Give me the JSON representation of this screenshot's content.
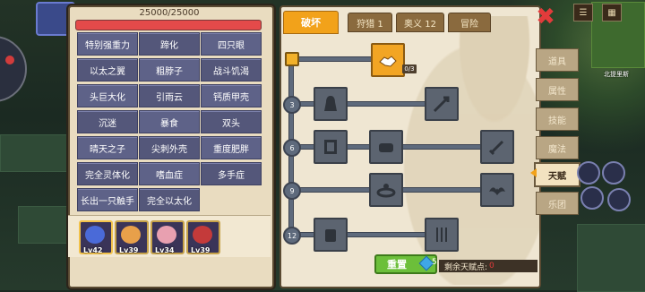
{
  "hp": {
    "text": "25000/25000",
    "fraction": 1.0
  },
  "modifiers": [
    [
      "特别强重力",
      "蹄化",
      "四只眼"
    ],
    [
      "以太之翼",
      "粗脖子",
      "战斗饥渴"
    ],
    [
      "头巨大化",
      "引雨云",
      "钙质甲壳"
    ],
    [
      "沉迷",
      "暴食",
      "双头"
    ],
    [
      "晴天之子",
      "尖刺外壳",
      "重度肥胖"
    ],
    [
      "完全灵体化",
      "嗜血症",
      "多手症"
    ],
    [
      "长出一只触手",
      "完全以太化"
    ]
  ],
  "units": [
    {
      "level": "Lv42",
      "color": "#4a6ad8"
    },
    {
      "level": "Lv39",
      "color": "#e8a04a"
    },
    {
      "level": "Lv34",
      "color": "#e8a0b0"
    },
    {
      "level": "Lv39",
      "color": "#c43a3a"
    }
  ],
  "tabs": [
    "破坏",
    "狩猎 1",
    "奥义 12",
    "冒险"
  ],
  "talent_tree": {
    "top_progress": "0/3",
    "rows": [
      "3",
      "6",
      "9",
      "12"
    ]
  },
  "side_menu": [
    "道具",
    "属性",
    "技能",
    "魔法",
    "天赋",
    "乐团"
  ],
  "active_side": "天赋",
  "reset": {
    "label": "重置",
    "cost": "5"
  },
  "remaining": {
    "label": "剩余天赋点:",
    "value": "0"
  },
  "map": {
    "label": "北提里斯"
  }
}
